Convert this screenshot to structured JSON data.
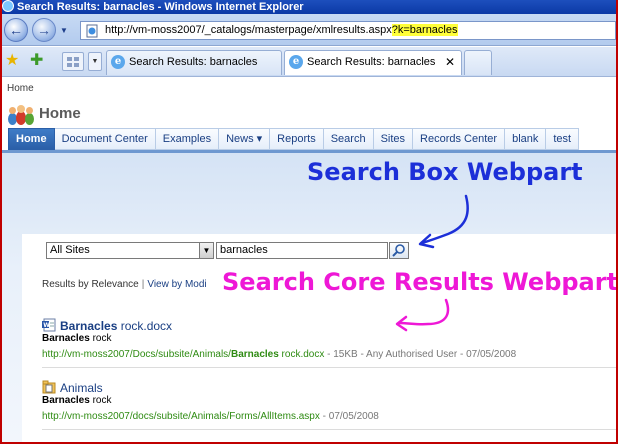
{
  "window": {
    "title": "Search Results: barnacles - Windows Internet Explorer"
  },
  "address": {
    "url_prefix": "http://vm-moss2007/_catalogs/masterpage/xmlresults.aspx",
    "url_query": "?k=barnacles"
  },
  "tabs": [
    {
      "label": "Search Results: barnacles"
    },
    {
      "label": "Search Results: barnacles"
    }
  ],
  "page": {
    "breadcrumb": "Home",
    "site_title": "Home",
    "nav": [
      "Home",
      "Document Center",
      "Examples",
      "News ▾",
      "Reports",
      "Search",
      "Sites",
      "Records Center",
      "blank",
      "test"
    ]
  },
  "annotations": {
    "search_box": "Search Box Webpart",
    "core_results": "Search Core Results Webpart"
  },
  "search": {
    "scope": "All Sites",
    "query": "barnacles"
  },
  "results_header": {
    "relevance": "Results by Relevance",
    "separator": "|",
    "view_by": "View by Modi"
  },
  "results": [
    {
      "title_hit": "Barnacles",
      "title_rest": " rock.docx",
      "desc_hit": "Barnacles",
      "desc_rest": " rock",
      "url_prefix": "http://vm-moss2007/Docs/subsite/Animals/",
      "url_hit": "Barnacles",
      "url_rest": " rock.docx",
      "meta": " - 15KB - Any Authorised User - 07/05/2008"
    },
    {
      "title": "Animals",
      "desc_hit": "Barnacles",
      "desc_rest": " rock",
      "url": "http://vm-moss2007/docs/subsite/Animals/Forms/AllItems.aspx",
      "meta": " - 07/05/2008"
    }
  ],
  "colors": {
    "annotation_blue": "#1c2fd8",
    "annotation_magenta": "#ee18d6",
    "link_blue": "#1a3f83",
    "url_green": "#2e8b12",
    "highlight": "#ffff3a"
  }
}
